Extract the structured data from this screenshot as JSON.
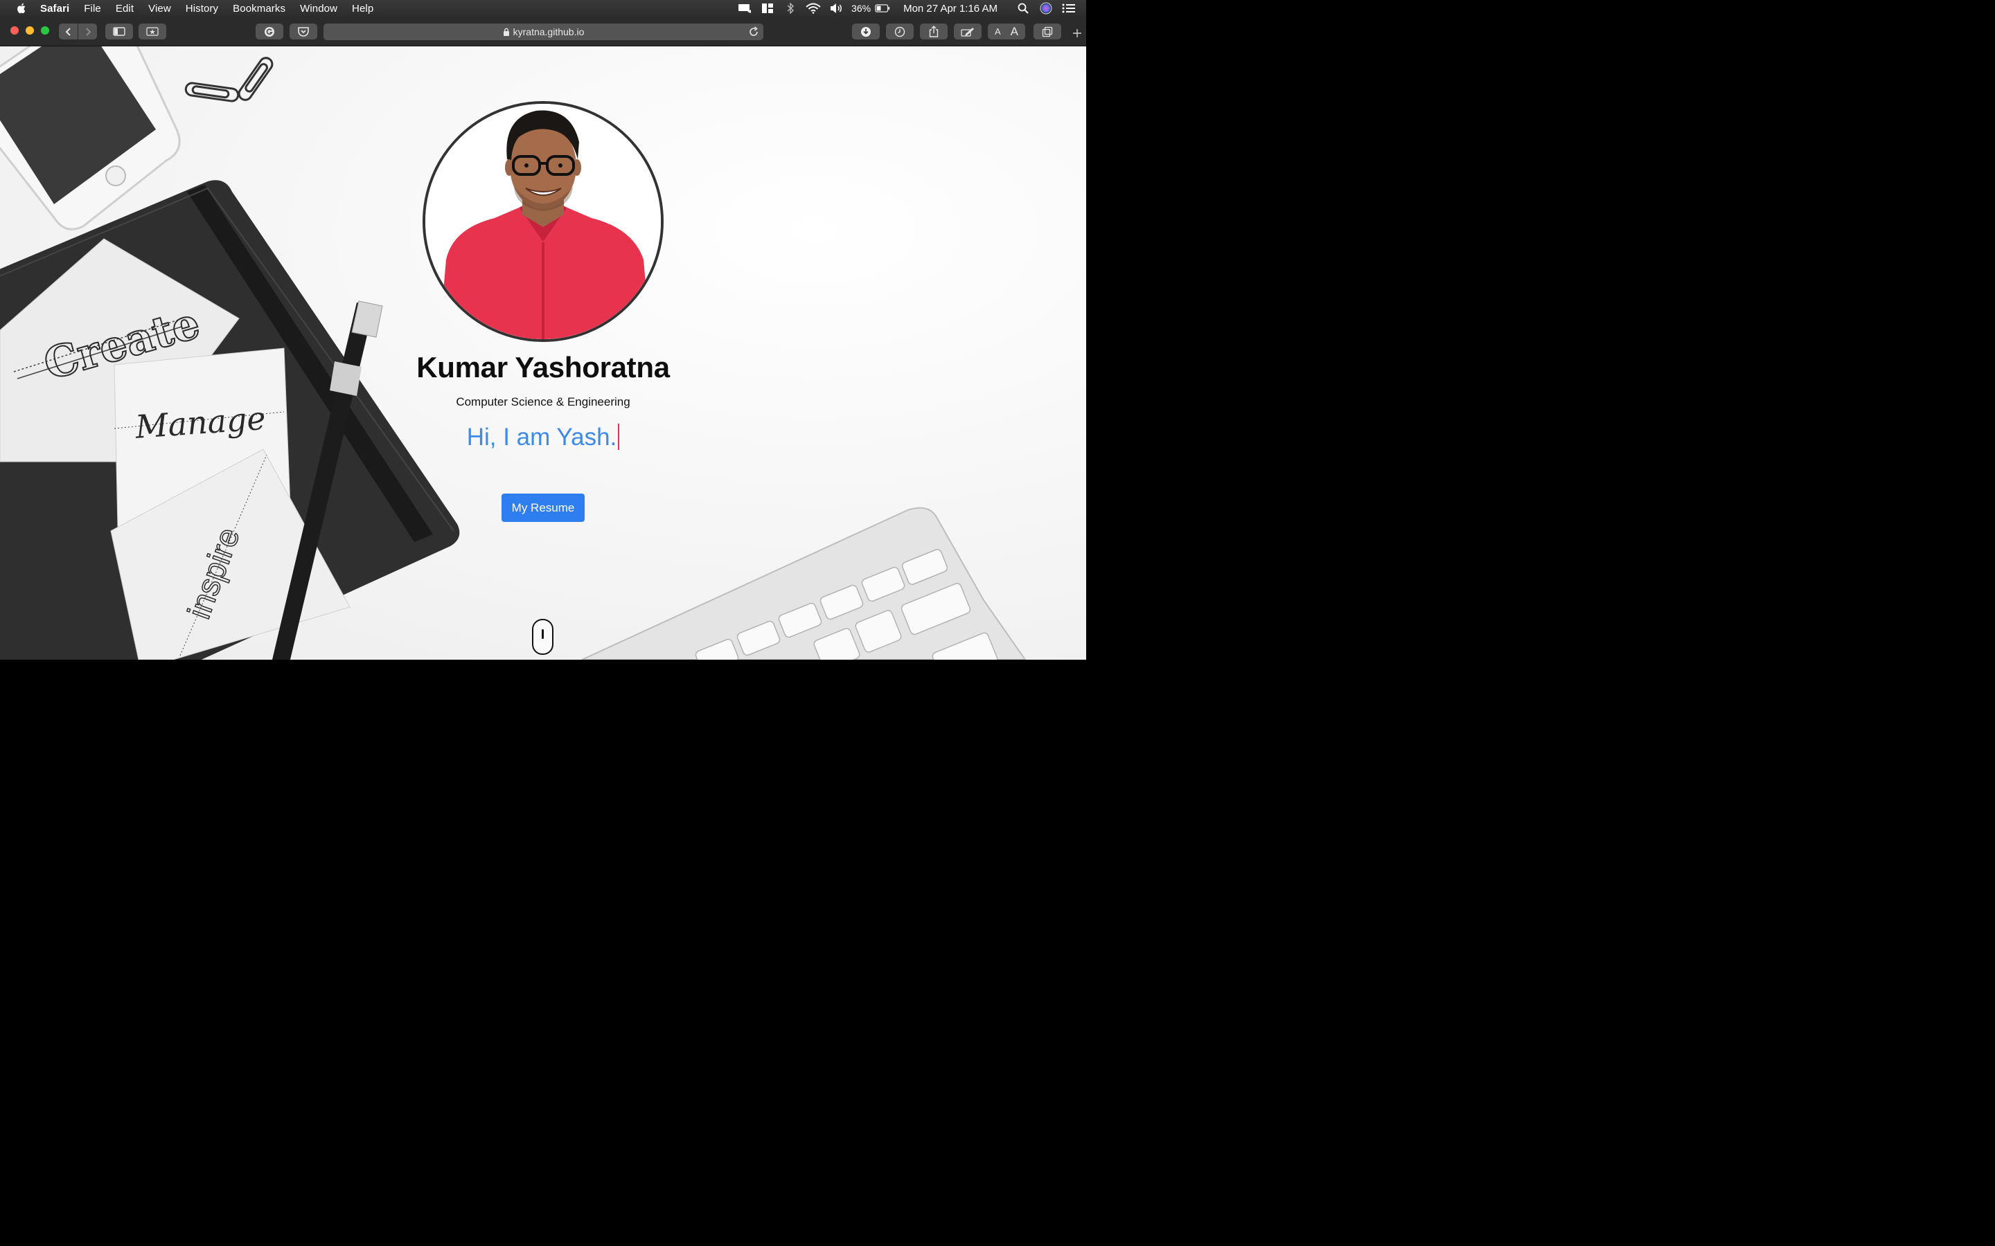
{
  "menubar": {
    "app_name": "Safari",
    "items": [
      "File",
      "Edit",
      "View",
      "History",
      "Bookmarks",
      "Window",
      "Help"
    ],
    "battery_percent": "36%",
    "clock": "Mon 27 Apr  1:16 AM"
  },
  "toolbar": {
    "url": "kyratna.github.io",
    "text_size_small": "A",
    "text_size_large": "A"
  },
  "hero": {
    "name": "Kumar Yashoratna",
    "subtitle": "Computer Science & Engineering",
    "typed_text": "Hi, I am Yash.",
    "resume_button": "My Resume"
  },
  "background": {
    "note_words": [
      "Create",
      "Manage",
      "inspire"
    ]
  },
  "colors": {
    "accent_blue": "#2f7ef0",
    "typed_blue": "#3d8ae8",
    "cursor_red": "#d9345a",
    "shirt_red": "#e8334f"
  }
}
